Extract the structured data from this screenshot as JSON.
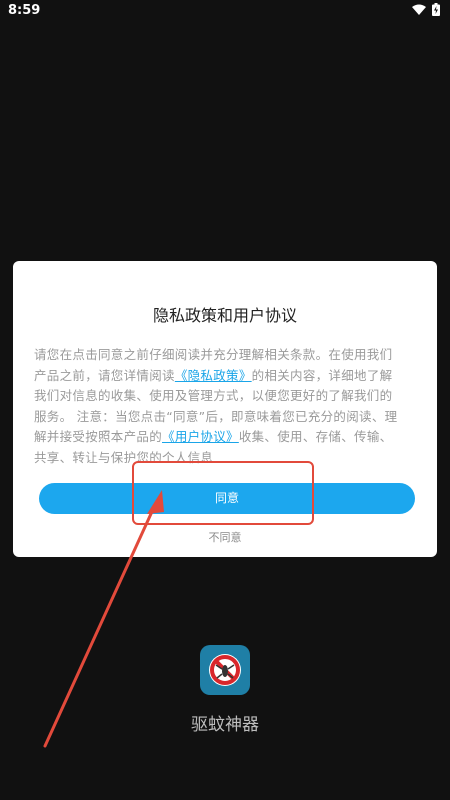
{
  "status_bar": {
    "time": "8:59",
    "wifi_icon": "wifi-icon",
    "battery_icon": "battery-icon"
  },
  "dialog": {
    "title": "隐私政策和用户协议",
    "body_lines": [
      "请您在点击同意之前仔细阅读并充分理解相关条款。在使用我们",
      "产品之前，请您详情阅读",
      "的相关内容，详细地了解",
      "我们对信息的收集、使用及管理方式，以便您更好的了解我们的",
      "服务。 注意：当您点击“同意”后，即意味着您已充分的阅读、理",
      "解并接受按照本产品的",
      "收集、使用、存储、传输、",
      "共享、转让与保护您的个人信息"
    ],
    "privacy_link": "《隐私政策》",
    "agreement_link": "《用户协议》",
    "agree_label": "同意",
    "disagree_label": "不同意"
  },
  "app": {
    "name": "驱蚊神器",
    "icon": "mosquito-ban-icon"
  },
  "colors": {
    "accent": "#1ca7ee",
    "annotation": "#e24a3b",
    "background": "#111111"
  }
}
